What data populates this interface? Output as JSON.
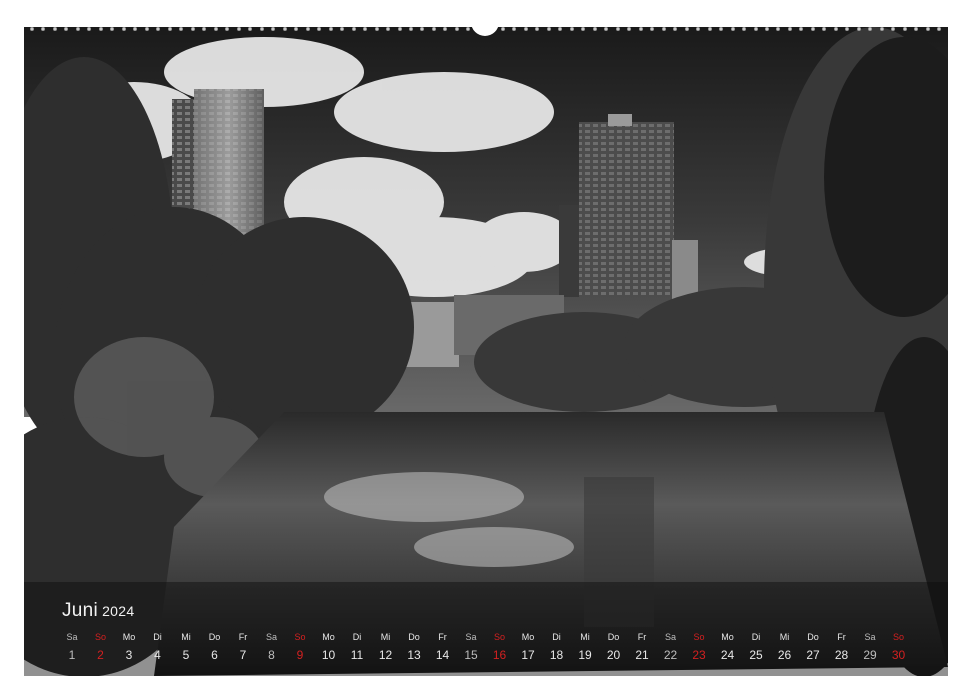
{
  "calendar": {
    "month": "Juni",
    "year": "2024",
    "accent_color": "#d32020",
    "days": [
      {
        "dn": "Sa",
        "num": "1",
        "type": "sat"
      },
      {
        "dn": "So",
        "num": "2",
        "type": "sun"
      },
      {
        "dn": "Mo",
        "num": "3",
        "type": "day"
      },
      {
        "dn": "Di",
        "num": "4",
        "type": "day"
      },
      {
        "dn": "Mi",
        "num": "5",
        "type": "day"
      },
      {
        "dn": "Do",
        "num": "6",
        "type": "day"
      },
      {
        "dn": "Fr",
        "num": "7",
        "type": "day"
      },
      {
        "dn": "Sa",
        "num": "8",
        "type": "sat"
      },
      {
        "dn": "So",
        "num": "9",
        "type": "sun"
      },
      {
        "dn": "Mo",
        "num": "10",
        "type": "day"
      },
      {
        "dn": "Di",
        "num": "11",
        "type": "day"
      },
      {
        "dn": "Mi",
        "num": "12",
        "type": "day"
      },
      {
        "dn": "Do",
        "num": "13",
        "type": "day"
      },
      {
        "dn": "Fr",
        "num": "14",
        "type": "day"
      },
      {
        "dn": "Sa",
        "num": "15",
        "type": "sat"
      },
      {
        "dn": "So",
        "num": "16",
        "type": "sun"
      },
      {
        "dn": "Mo",
        "num": "17",
        "type": "day"
      },
      {
        "dn": "Di",
        "num": "18",
        "type": "day"
      },
      {
        "dn": "Mi",
        "num": "19",
        "type": "day"
      },
      {
        "dn": "Do",
        "num": "20",
        "type": "day"
      },
      {
        "dn": "Fr",
        "num": "21",
        "type": "day"
      },
      {
        "dn": "Sa",
        "num": "22",
        "type": "sat"
      },
      {
        "dn": "So",
        "num": "23",
        "type": "sun"
      },
      {
        "dn": "Mo",
        "num": "24",
        "type": "day"
      },
      {
        "dn": "Di",
        "num": "25",
        "type": "day"
      },
      {
        "dn": "Mi",
        "num": "26",
        "type": "day"
      },
      {
        "dn": "Do",
        "num": "27",
        "type": "day"
      },
      {
        "dn": "Fr",
        "num": "28",
        "type": "day"
      },
      {
        "dn": "Sa",
        "num": "29",
        "type": "sat"
      },
      {
        "dn": "So",
        "num": "30",
        "type": "sun"
      }
    ]
  }
}
